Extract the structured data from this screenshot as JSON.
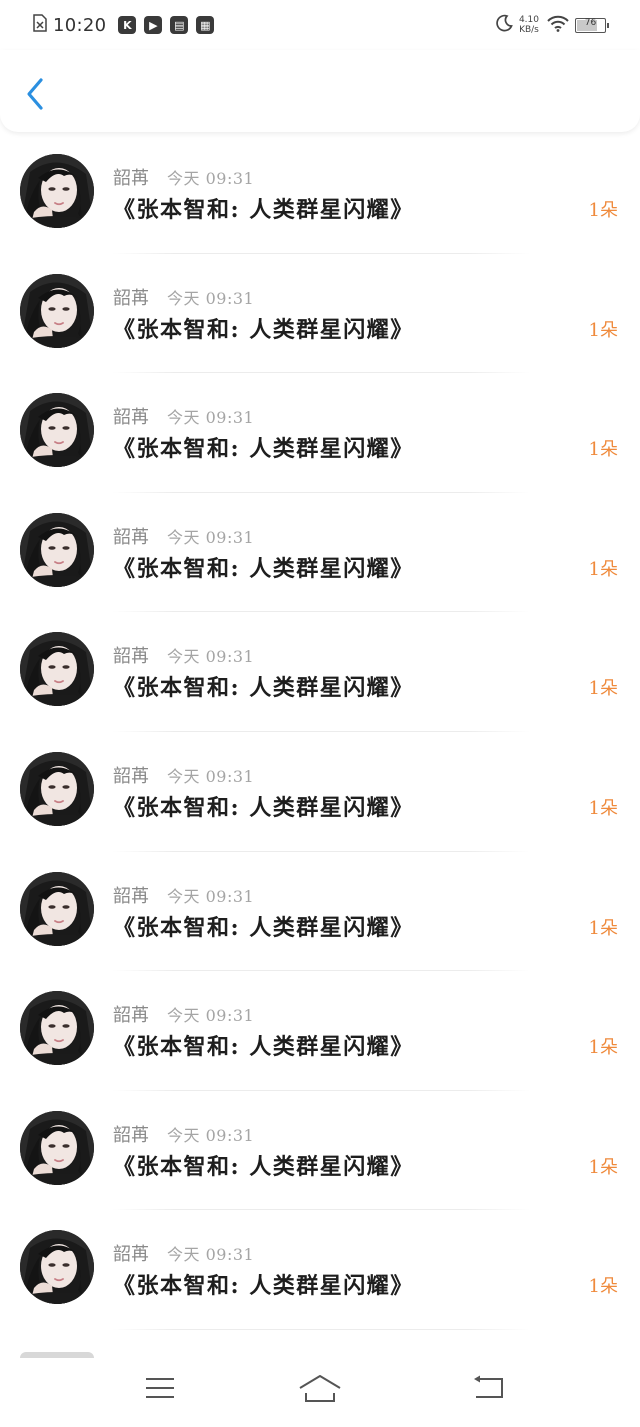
{
  "status_bar": {
    "time": "10:20",
    "apps": [
      "K",
      "▶",
      "▤",
      "▦"
    ],
    "net_speed_value": "4.10",
    "net_speed_unit": "KB/s",
    "battery": "76",
    "battery_level": 0.76
  },
  "header": {
    "back_icon": "chevron-left-icon",
    "accent": "#2b8fe0"
  },
  "list": {
    "items": [
      {
        "nickname": "韶苒",
        "time": "今天 09:31",
        "title": "《张本智和: 人类群星闪耀》",
        "count": "1朵"
      },
      {
        "nickname": "韶苒",
        "time": "今天 09:31",
        "title": "《张本智和: 人类群星闪耀》",
        "count": "1朵"
      },
      {
        "nickname": "韶苒",
        "time": "今天 09:31",
        "title": "《张本智和: 人类群星闪耀》",
        "count": "1朵"
      },
      {
        "nickname": "韶苒",
        "time": "今天 09:31",
        "title": "《张本智和: 人类群星闪耀》",
        "count": "1朵"
      },
      {
        "nickname": "韶苒",
        "time": "今天 09:31",
        "title": "《张本智和: 人类群星闪耀》",
        "count": "1朵"
      },
      {
        "nickname": "韶苒",
        "time": "今天 09:31",
        "title": "《张本智和: 人类群星闪耀》",
        "count": "1朵"
      },
      {
        "nickname": "韶苒",
        "time": "今天 09:31",
        "title": "《张本智和: 人类群星闪耀》",
        "count": "1朵"
      },
      {
        "nickname": "韶苒",
        "time": "今天 09:31",
        "title": "《张本智和: 人类群星闪耀》",
        "count": "1朵"
      },
      {
        "nickname": "韶苒",
        "time": "今天 09:31",
        "title": "《张本智和: 人类群星闪耀》",
        "count": "1朵"
      },
      {
        "nickname": "韶苒",
        "time": "今天 09:31",
        "title": "《张本智和: 人类群星闪耀》",
        "count": "1朵"
      }
    ],
    "count_color": "#ef8a3c"
  },
  "nav_bar": {
    "buttons": [
      "menu-icon",
      "home-icon",
      "back-icon"
    ]
  }
}
